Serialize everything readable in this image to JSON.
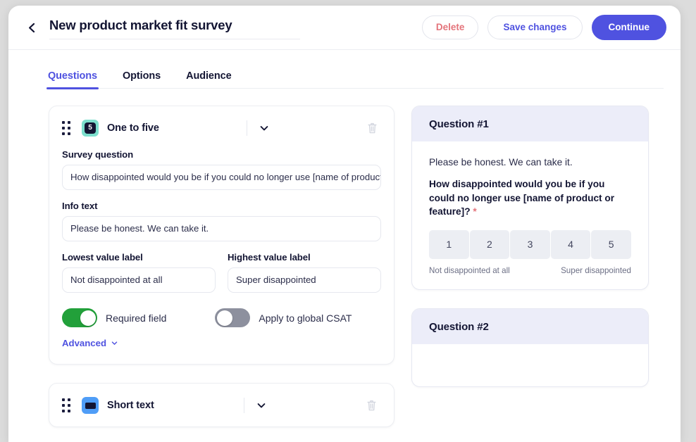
{
  "header": {
    "back_icon": "chevron-left-icon",
    "title": "New product market fit survey",
    "delete_label": "Delete",
    "save_label": "Save changes",
    "continue_label": "Continue",
    "accent_color": "#4f52e0",
    "danger_color": "#e4747b"
  },
  "tabs": [
    {
      "label": "Questions",
      "active": true
    },
    {
      "label": "Options",
      "active": false
    },
    {
      "label": "Audience",
      "active": false
    }
  ],
  "editor": {
    "question1": {
      "type_label": "One to five",
      "type_icon": "one-to-five-icon",
      "type_badge": "5",
      "icon_color": "#7ddfcd",
      "survey_question_label": "Survey question",
      "survey_question_value": "How disappointed would you be if you could no longer use [name of product",
      "info_text_label": "Info text",
      "info_text_value": "Please be honest. We can take it.",
      "lowest_label": "Lowest value label",
      "lowest_value": "Not disappointed at all",
      "highest_label": "Highest value label",
      "highest_value": "Super disappointed",
      "required_toggle": {
        "label": "Required field",
        "state": "on",
        "color": "#22a03a"
      },
      "csat_toggle": {
        "label": "Apply to global CSAT",
        "state": "off",
        "color": "#8d909e"
      },
      "advanced_label": "Advanced"
    },
    "question2": {
      "type_label": "Short text",
      "type_icon": "short-text-icon",
      "icon_color": "#4f9df7"
    }
  },
  "preview": {
    "card1": {
      "heading": "Question #1",
      "info_text": "Please be honest. We can take it.",
      "question_text": "How disappointed would you be if you could no longer use [name of product or feature]?",
      "required_marker": "*",
      "scale_options": [
        "1",
        "2",
        "3",
        "4",
        "5"
      ],
      "low_label": "Not disappointed at all",
      "high_label": "Super disappointed"
    },
    "card2": {
      "heading": "Question #2"
    }
  }
}
